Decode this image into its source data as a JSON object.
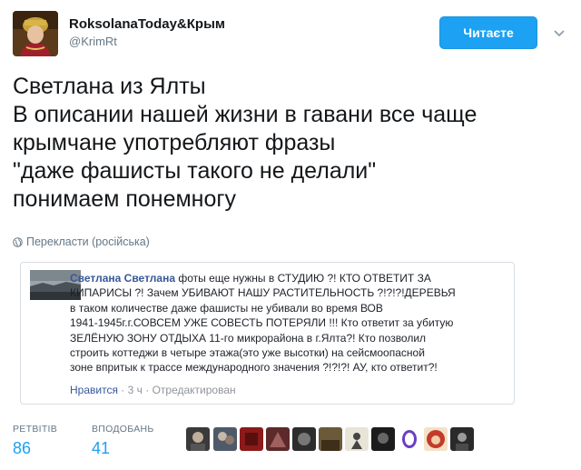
{
  "header": {
    "display_name": "RoksolanaToday&Крым",
    "handle": "@KrimRt",
    "follow_label": "Читаєте"
  },
  "tweet": {
    "lines": [
      "Светлана из Ялты",
      "В описании нашей жизни в гавани все чаще",
      "крымчане употребляют фразы",
      "\"даже фашисты такого не делали\"",
      "понимаем понемногу"
    ],
    "translate_label": "Перекласти (російська)"
  },
  "embed": {
    "author": "Светлана Светлана",
    "lines": [
      " фоты еще нужны в СТУДИЮ ?! КТО ОТВЕТИТ ЗА",
      "КИПАРИСЫ ?! Зачем УБИВАЮТ НАШУ РАСТИТЕЛЬНОСТЬ ?!?!?!ДЕРЕВЬЯ",
      "в таком количестве даже фашисты не убивали во время ВОВ",
      "1941-1945г.г.СОВСЕМ УЖЕ СОВЕСТЬ ПОТЕРЯЛИ !!! Кто ответит за убитую",
      "ЗЕЛЁНУЮ ЗОНУ ОТДЫХА 11-го микрорайона в г.Ялта?! Кто позволил",
      "строить коттеджи в четыре этажа(это уже высотки) на сейсмоопасной",
      "зоне впритык к трассе международного значения ?!?!?! АУ, кто ответит?!"
    ],
    "like_label": "Нравится",
    "time": "3 ч",
    "edited": "Отредактирован",
    "separator": " · "
  },
  "stats": {
    "retweets_label": "РЕТВІТІВ",
    "retweets_value": "86",
    "likes_label": "ВПОДОБАНЬ",
    "likes_value": "41"
  },
  "likers": {
    "colors": [
      "#3a3a3a",
      "#4e5a6a",
      "#8b1a1a",
      "#5c2a2a",
      "#2d2d2d",
      "#6b5a3a",
      "#e8e4d8",
      "#1c1c1c",
      "#6a3fc2",
      "#c23b2b",
      "#2a2a2a"
    ]
  },
  "colors": {
    "accent": "#1da1f2",
    "fb_link": "#365899"
  }
}
